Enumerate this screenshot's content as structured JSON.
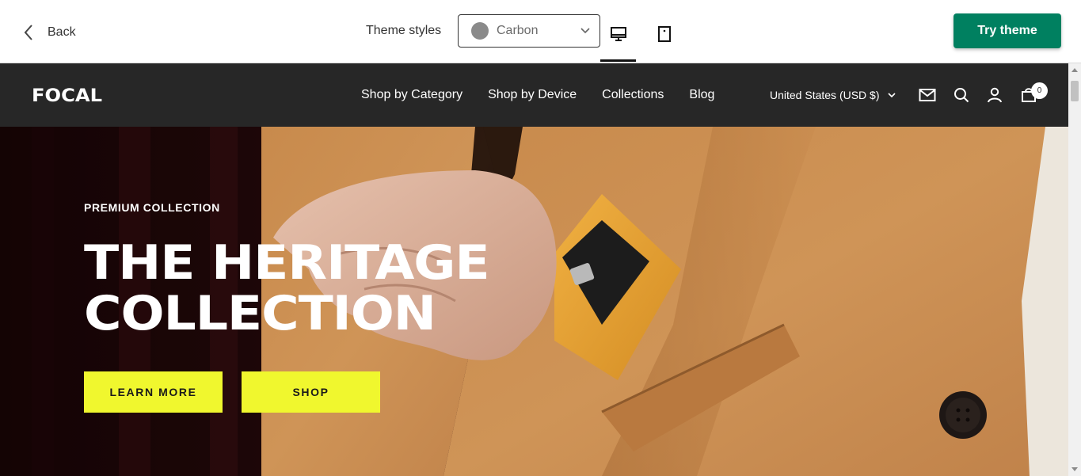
{
  "toolbar": {
    "back_label": "Back",
    "theme_styles_label": "Theme styles",
    "theme_style_value": "Carbon",
    "swatch_color": "#8a8a8a",
    "try_label": "Try theme",
    "try_color": "#008060",
    "active_device": "desktop"
  },
  "store": {
    "logo": "FOCAL",
    "nav": [
      "Shop by Category",
      "Shop by Device",
      "Collections",
      "Blog"
    ],
    "currency": "United States (USD $)",
    "cart_count": "0",
    "icons": [
      "mail-icon",
      "search-icon",
      "account-icon",
      "cart-icon"
    ]
  },
  "hero": {
    "eyebrow": "PREMIUM COLLECTION",
    "title_line1": "THE HERITAGE",
    "title_line2": "COLLECTION",
    "learn_more": "LEARN MORE",
    "shop": "SHOP",
    "button_color": "#f0f72e"
  }
}
